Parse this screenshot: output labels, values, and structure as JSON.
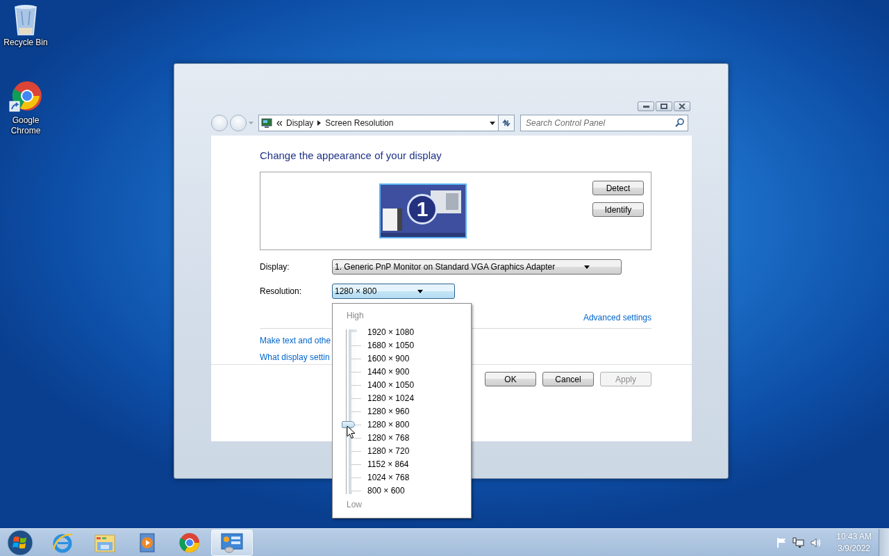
{
  "desktop": {
    "icons": [
      {
        "kind": "recycle-bin",
        "label": "Recycle Bin"
      },
      {
        "kind": "chrome-shortcut",
        "label": "Google Chrome"
      }
    ]
  },
  "window": {
    "address_bar": {
      "crumbs": [
        "Display",
        "Screen Resolution"
      ]
    },
    "search": {
      "placeholder": "Search Control Panel"
    },
    "heading": "Change the appearance of your display",
    "monitor_number": "1",
    "side_buttons": [
      "Detect",
      "Identify"
    ],
    "fields": [
      {
        "label": "Display:",
        "value": "1. Generic PnP Monitor on Standard VGA Graphics Adapter",
        "expanded": false
      },
      {
        "label": "Resolution:",
        "value": "1280 × 800",
        "expanded": true
      }
    ],
    "advanced_link": "Advanced settings",
    "links": [
      "Make text and othe",
      "What display settin"
    ],
    "buttons": [
      {
        "label": "OK",
        "disabled": false
      },
      {
        "label": "Cancel",
        "disabled": false
      },
      {
        "label": "Apply",
        "disabled": true
      }
    ]
  },
  "resolution_popup": {
    "high_label": "High",
    "low_label": "Low",
    "level": 0.4167,
    "options": [
      "1920 × 1080",
      "1680 × 1050",
      "1600 × 900",
      "1440 × 900",
      "1400 × 1050",
      "1280 × 1024",
      "1280 × 960",
      "1280 × 800",
      "1280 × 768",
      "1280 × 720",
      "1152 × 864",
      "1024 × 768",
      "800 × 600"
    ]
  },
  "taskbar": {
    "apps": [
      {
        "kind": "start",
        "active": false
      },
      {
        "kind": "ie",
        "active": false
      },
      {
        "kind": "explorer",
        "active": false
      },
      {
        "kind": "media",
        "active": false
      },
      {
        "kind": "chrome",
        "active": false
      },
      {
        "kind": "control-panel",
        "active": true
      }
    ],
    "clock": {
      "time": "10:43 AM",
      "date": "3/9/2022"
    }
  }
}
